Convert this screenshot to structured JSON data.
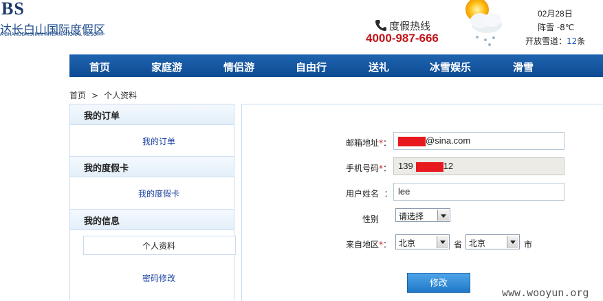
{
  "header": {
    "logo_text": "BS",
    "logo_cn": "达长白山国际度假区",
    "logo_en": "A CHANGBAISHAN INTERNATIONAL RESORT",
    "hotline_label": "度假热线",
    "hotline_number": "4000-987-666",
    "weather": {
      "date": "02月28日",
      "condition": "阵雪 -8℃",
      "slopes_prefix": "开放雪道：",
      "slopes_count": "12",
      "slopes_suffix": "条"
    }
  },
  "nav": {
    "items": [
      "首页",
      "家庭游",
      "情侣游",
      "自由行",
      "送礼",
      "冰雪娱乐",
      "滑雪"
    ]
  },
  "breadcrumb": {
    "home": "首页",
    "separator": ">",
    "current": "个人资料"
  },
  "sidebar": {
    "orders_heading": "我的订单",
    "orders_link": "我的订单",
    "cards_heading": "我的度假卡",
    "cards_link": "我的度假卡",
    "info_heading": "我的信息",
    "profile_link": "个人资料",
    "password_link": "密码修改"
  },
  "form": {
    "email_label": "邮箱地址",
    "email_value_suffix": "@sina.com",
    "phone_label": "手机号码",
    "phone_prefix": "139",
    "phone_suffix": "12",
    "name_label": "用户姓名",
    "name_value": "lee",
    "gender_label": "性别",
    "gender_value": "请选择",
    "region_label": "来自地区",
    "province_value": "北京",
    "province_unit": "省",
    "city_value": "北京",
    "city_unit": "市",
    "required_mark": "*",
    "colon": "：",
    "submit_label": "修改"
  },
  "watermark": "www.wooyun.org",
  "colors": {
    "nav_bg": "#1a5aa6",
    "hotline_red": "#c0151a",
    "button_blue": "#2a86d4",
    "redaction": "#e8191e"
  }
}
